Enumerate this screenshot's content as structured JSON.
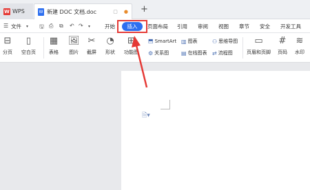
{
  "titlebar": {
    "app_tab": "WPS",
    "app_logo": "W",
    "doc_tab": "新建 DOC 文档.doc",
    "doc_icon": "W",
    "new_tab": "+"
  },
  "menubar": {
    "file": "文件",
    "items": [
      "开始",
      "插入",
      "页面布局",
      "引用",
      "审阅",
      "视图",
      "章节",
      "安全",
      "开发工具"
    ]
  },
  "ribbon": {
    "page_break": "分页",
    "blank_page": "空白页",
    "table": "表格",
    "picture": "图片",
    "screenshot": "截屏",
    "shape": "形状",
    "function_chart": "功能图",
    "smartart": "SmartArt",
    "chart": "图表",
    "mind_map": "思维导图",
    "relation_chart": "关系图",
    "online_chart": "在线图表",
    "flowchart": "流程图",
    "header_footer": "页眉和页脚",
    "page_number": "页码",
    "watermark": "水印"
  },
  "colors": {
    "accent": "#2d6ff0",
    "highlight": "#e53935"
  }
}
